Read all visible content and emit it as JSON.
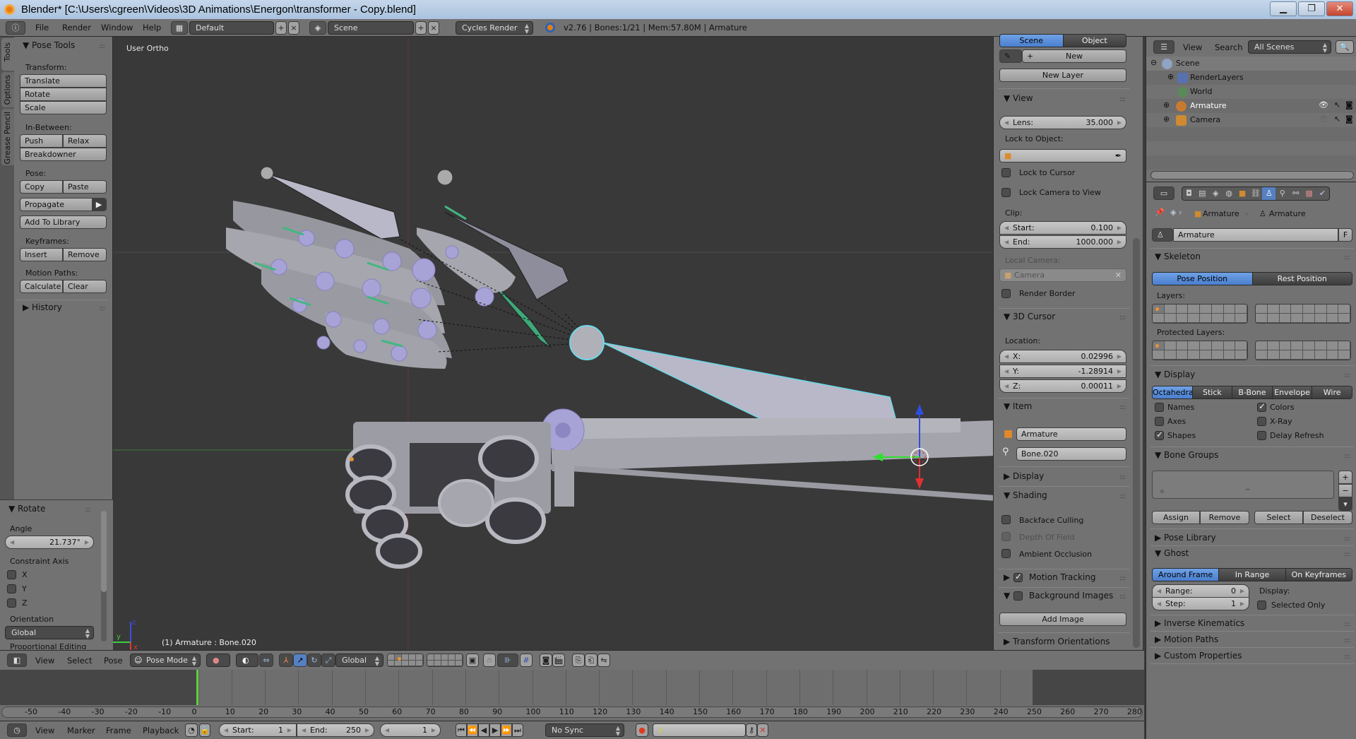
{
  "window": {
    "title": "Blender* [C:\\Users\\cgreen\\Videos\\3D Animations\\Energon\\transformer - Copy.blend]",
    "buttons": [
      "minimize",
      "restore",
      "close"
    ]
  },
  "info_header": {
    "menus": [
      "File",
      "Render",
      "Window",
      "Help"
    ],
    "layout": "Default",
    "scene": "Scene",
    "render_engine": "Cycles Render",
    "stats": "v2.76 | Bones:1/21  | Mem:57.80M | Armature"
  },
  "toolshelf": {
    "tabs": [
      "Tools",
      "Options",
      "Grease Pencil"
    ],
    "panel_title": "Pose Tools",
    "transform_label": "Transform:",
    "transform_buttons": [
      "Translate",
      "Rotate",
      "Scale"
    ],
    "inbetween_label": "In-Between:",
    "push": "Push",
    "relax": "Relax",
    "breakdowner": "Breakdowner",
    "pose_label": "Pose:",
    "copy": "Copy",
    "paste": "Paste",
    "propagate": "Propagate",
    "add_to_library": "Add To Library",
    "keyframes_label": "Keyframes:",
    "insert": "Insert",
    "remove": "Remove",
    "motion_paths_label": "Motion Paths:",
    "calculate": "Calculate",
    "clear": "Clear",
    "history": "History"
  },
  "operator_panel": {
    "title": "Rotate",
    "angle_label": "Angle",
    "angle_value": "21.737°",
    "constraint_label": "Constraint Axis",
    "axes": [
      {
        "label": "X",
        "checked": false
      },
      {
        "label": "Y",
        "checked": false
      },
      {
        "label": "Z",
        "checked": false
      }
    ],
    "orientation_label": "Orientation",
    "orientation_value": "Global",
    "cut_off_label": "Proportional Editing"
  },
  "viewport": {
    "view_name": "User Ortho",
    "status": "(1) Armature : Bone.020",
    "axis_labels": {
      "x": "x",
      "y": "y",
      "z": "z"
    }
  },
  "npanel": {
    "gp_tabs": [
      "Scene",
      "Object"
    ],
    "new": "New",
    "new_layer": "New Layer",
    "view": {
      "title": "View",
      "lens_label": "Lens:",
      "lens_value": "35.000",
      "lock_object_label": "Lock to Object:",
      "lock_to_cursor": "Lock to Cursor",
      "lock_camera": "Lock Camera to View",
      "clip_label": "Clip:",
      "clip_start_label": "Start:",
      "clip_start": "0.100",
      "clip_end_label": "End:",
      "clip_end": "1000.000",
      "local_camera_label": "Local Camera:",
      "local_camera": "Camera",
      "render_border": "Render Border"
    },
    "cursor": {
      "title": "3D Cursor",
      "location_label": "Location:",
      "x_label": "X:",
      "x": "0.02996",
      "y_label": "Y:",
      "y": "-1.28914",
      "z_label": "Z:",
      "z": "0.00011"
    },
    "item": {
      "title": "Item",
      "object": "Armature",
      "bone": "Bone.020"
    },
    "display_title": "Display",
    "shading": {
      "title": "Shading",
      "backface": "Backface Culling",
      "dof": "Depth Of Field",
      "ao": "Ambient Occlusion"
    },
    "motion_tracking": "Motion Tracking",
    "motion_tracking_checked": true,
    "background_images": "Background Images",
    "add_image": "Add Image",
    "transform_orientations": "Transform Orientations"
  },
  "outliner": {
    "menus": [
      "View",
      "Search"
    ],
    "filter": "All Scenes",
    "items": [
      {
        "label": "Scene",
        "depth": 0
      },
      {
        "label": "RenderLayers",
        "depth": 1
      },
      {
        "label": "World",
        "depth": 1
      },
      {
        "label": "Armature",
        "depth": 1
      },
      {
        "label": "Camera",
        "depth": 1
      }
    ]
  },
  "properties": {
    "breadcrumb": [
      "Armature",
      "Armature"
    ],
    "datablock": "Armature",
    "fake_user": "F",
    "skeleton": {
      "title": "Skeleton",
      "pose_position": "Pose Position",
      "rest_position": "Rest Position",
      "layers_label": "Layers:",
      "protected_label": "Protected Layers:"
    },
    "display": {
      "title": "Display",
      "modes": [
        "Octahedral",
        "Stick",
        "B-Bone",
        "Envelope",
        "Wire"
      ],
      "active_mode": "Octahedral",
      "options": [
        {
          "label": "Names",
          "checked": false
        },
        {
          "label": "Colors",
          "checked": true
        },
        {
          "label": "Axes",
          "checked": false
        },
        {
          "label": "X-Ray",
          "checked": false
        },
        {
          "label": "Shapes",
          "checked": true
        },
        {
          "label": "Delay Refresh",
          "checked": false
        }
      ]
    },
    "bone_groups": {
      "title": "Bone Groups",
      "assign": "Assign",
      "remove": "Remove",
      "select": "Select",
      "deselect": "Deselect"
    },
    "pose_library": "Pose Library",
    "ghost": {
      "title": "Ghost",
      "modes": [
        "Around Frame",
        "In Range",
        "On Keyframes"
      ],
      "range_label": "Range:",
      "range": "0",
      "step_label": "Step:",
      "step": "1",
      "display_label": "Display:",
      "selected_only": "Selected Only"
    },
    "collapsed": [
      "Inverse Kinematics",
      "Motion Paths",
      "Custom Properties"
    ]
  },
  "view3d_header": {
    "menus": [
      "View",
      "Select",
      "Pose"
    ],
    "mode": "Pose Mode",
    "orientation": "Global"
  },
  "timeline": {
    "ticks": [
      "-50",
      "-40",
      "-30",
      "-20",
      "-10",
      "0",
      "10",
      "20",
      "30",
      "40",
      "50",
      "60",
      "70",
      "80",
      "90",
      "100",
      "110",
      "120",
      "130",
      "140",
      "150",
      "160",
      "170",
      "180",
      "190",
      "200",
      "210",
      "220",
      "230",
      "240",
      "250",
      "260",
      "270",
      "280"
    ],
    "current_frame_marker": 0,
    "menus": [
      "View",
      "Marker",
      "Frame",
      "Playback"
    ],
    "start_label": "Start:",
    "start": "1",
    "end_label": "End:",
    "end": "250",
    "current": "1",
    "sync": "No Sync"
  },
  "colors": {
    "accent": "#5680c2",
    "bone_selected": "#6bd9e8",
    "bone_green": "#3aa872",
    "gear_purple": "#a8a3d6"
  }
}
